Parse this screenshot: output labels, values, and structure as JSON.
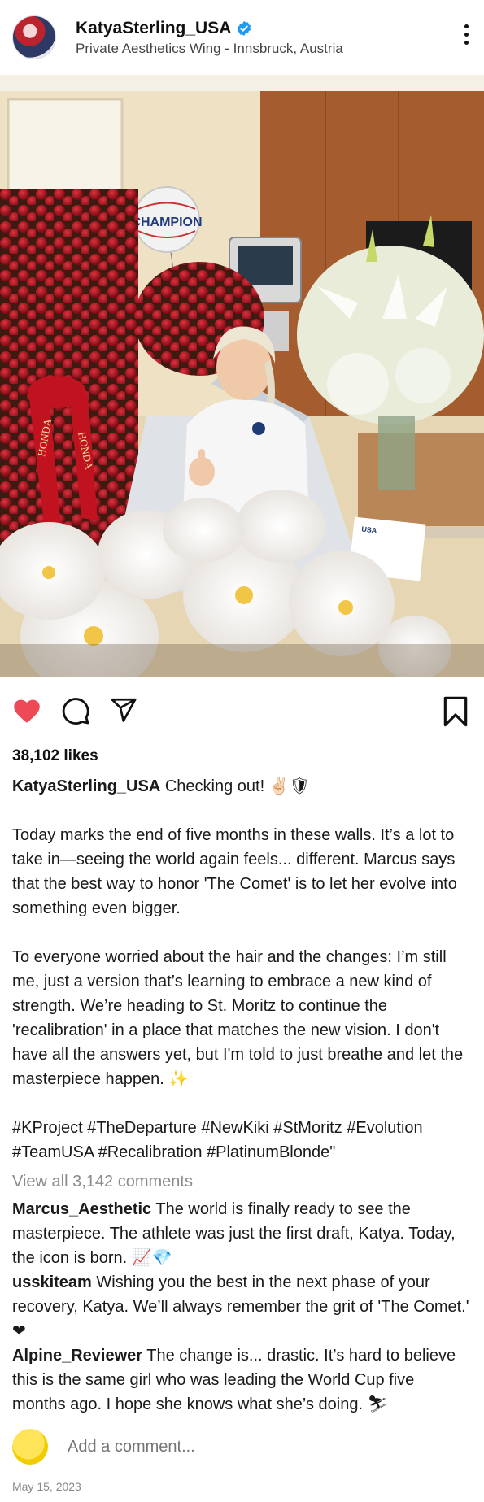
{
  "post": {
    "username": "KatyaSterling_USA",
    "location": "Private Aesthetics Wing - Innsbruck, Austria",
    "likes": "38,102 likes",
    "caption_user": "KatyaSterling_USA",
    "caption_lead": "Checking out! ✌🏻🛡",
    "paragraph1": "Today marks the end of five months in these walls. It’s a lot to take in—seeing the world again feels... different. Marcus says that the best way to honor 'The Comet' is to let her evolve into something even bigger.",
    "paragraph2": "To everyone worried about the hair and the changes: I’m still me, just a version that’s learning to embrace a new kind of strength. We’re heading to St. Moritz to continue the 'recalibration' in a place that matches the new vision. I don't have all the answers yet, but I'm told to just breathe and let the masterpiece happen. ✨",
    "hashtags": "#KProject #TheDeparture #NewKiki #StMoritz #Evolution #TeamUSA #Recalibration #PlatinumBlonde\"",
    "view_all": "View all 3,142 comments",
    "add_comment_placeholder": "Add a comment...",
    "date": "May 15, 2023"
  },
  "photo": {
    "balloon_text": "CHAMPION",
    "ribbon_text": "HONDA",
    "card_text": "USA"
  },
  "comments": [
    {
      "user": "Marcus_Aesthetic",
      "text": "The world is finally ready to see the masterpiece. The athlete was just the first draft, Katya. Today, the icon is born. 📈💎"
    },
    {
      "user": "usskiteam",
      "text": "Wishing you the best in the next phase of your recovery, Katya. We’ll always remember the grit of 'The Comet.' ❤"
    },
    {
      "user": "Alpine_Reviewer",
      "text": "The change is... drastic. It’s hard to believe this is the same girl who was leading the World Cup five months ago. I hope she knows what she’s doing. ⛷"
    }
  ],
  "icons": {
    "like": "heart-icon",
    "comment": "comment-icon",
    "share": "share-icon",
    "save": "bookmark-icon",
    "verified": "verified-badge-icon",
    "more": "more-options-icon"
  },
  "colors": {
    "like_active": "#ed4956",
    "verified": "#1d9bf0",
    "muted_text": "#8a8a8a"
  }
}
